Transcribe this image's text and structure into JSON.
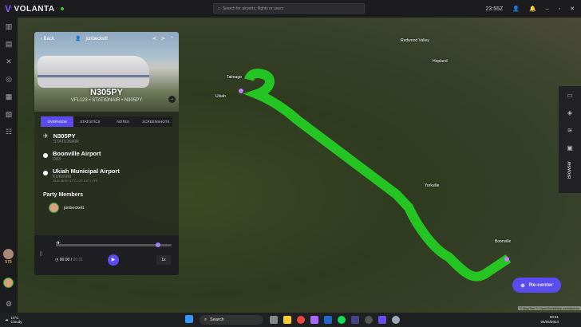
{
  "app": {
    "name": "VOLANTA",
    "search_placeholder": "Search for airports, flights or users",
    "utc_time": "23:55Z"
  },
  "sidebar": {
    "items": [
      "map",
      "flight-plan",
      "routes",
      "aircraft",
      "logbook",
      "reports",
      "community"
    ],
    "user_level": "578"
  },
  "map": {
    "labels": [
      "Ukiah",
      "Boonville",
      "Redwood Valley",
      "Talmage",
      "Hopland",
      "Yorkville"
    ],
    "attribution": "© MapTiler © OpenStreetMap contributors",
    "route_color": "#22dd22"
  },
  "panel": {
    "back": "Back",
    "username": "jonbeckett",
    "tail": "N305PY",
    "subtitle": "VFL123 • STATIONAIR • N305PY",
    "tabs": [
      "OVERVIEW",
      "STATISTICS",
      "NOTES",
      "SCREENSHOTS"
    ],
    "active_tab": "OVERVIEW",
    "aircraft": {
      "reg": "N305PY",
      "type": "STATIONAIR"
    },
    "departure": {
      "name": "Boonville Airport",
      "code": "D83"
    },
    "arrival": {
      "name": "Ukiah Municipal Airport",
      "code": "KUKI/UKI",
      "weather": "29.82 INHG • 17°C • 20° 6 KT • VFR"
    },
    "party_title": "Party Members",
    "members": [
      "jonbeckett"
    ],
    "player": {
      "time": "00:00",
      "duration": "00:31",
      "speed": "1x",
      "progress": 0.88
    }
  },
  "right": {
    "browser": "Browser"
  },
  "recenter": "Re-center",
  "taskbar": {
    "temp": "10°C",
    "weather": "Cloudy",
    "search": "Search",
    "time": "00:51",
    "date": "06/06/2024"
  }
}
